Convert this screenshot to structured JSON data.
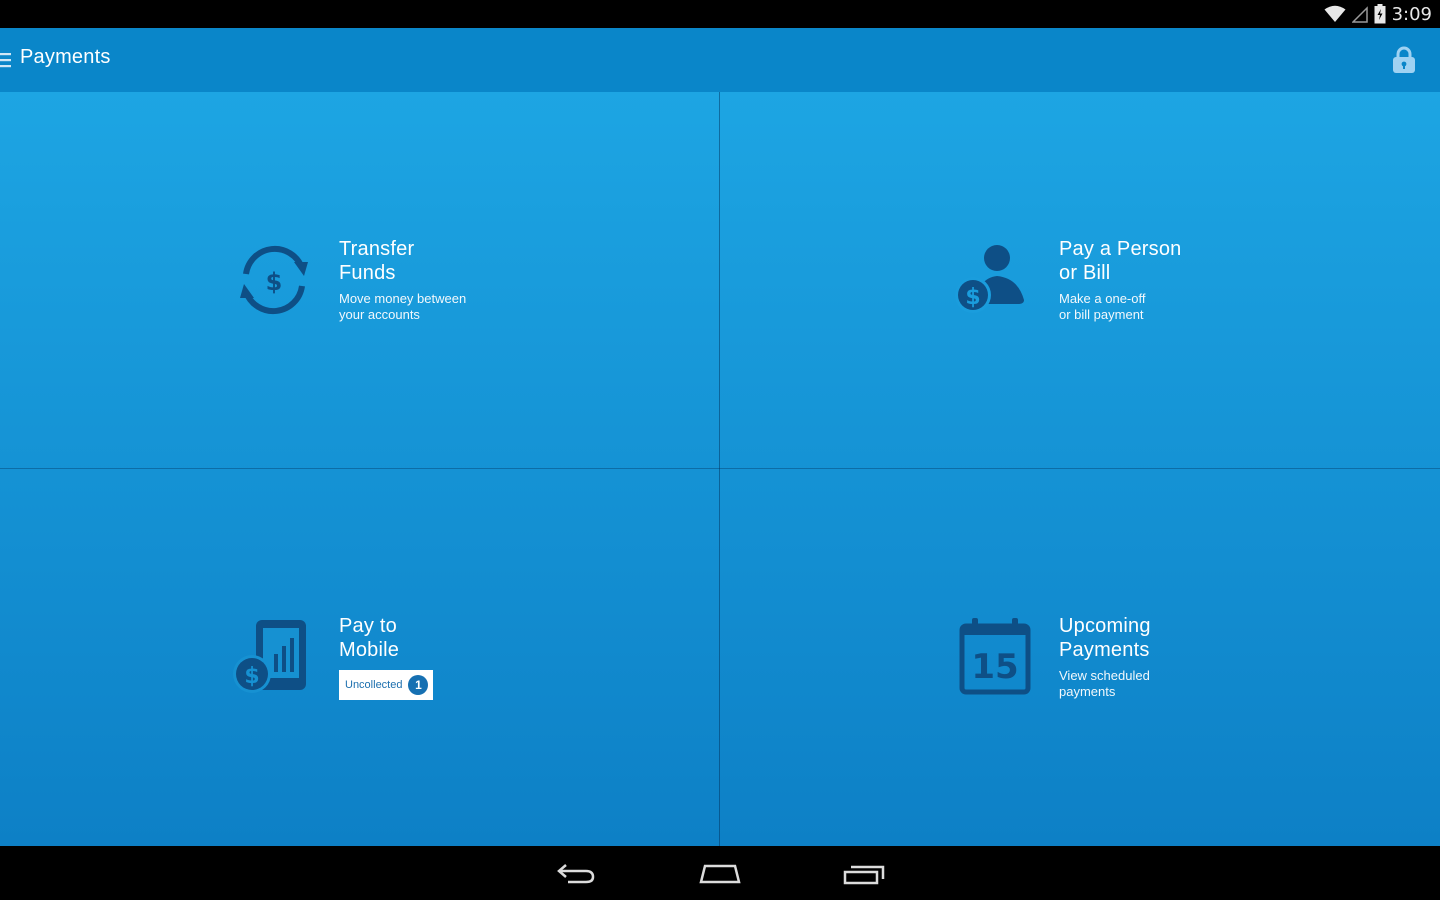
{
  "status": {
    "time": "3:09"
  },
  "appbar": {
    "title": "Payments",
    "menu_icon": "hamburger-menu-icon",
    "lock_icon": "lock-icon"
  },
  "tiles": [
    {
      "title_line1": "Transfer",
      "title_line2": "Funds",
      "desc_line1": "Move money between",
      "desc_line2": "your accounts",
      "icon": "transfer-funds-icon"
    },
    {
      "title_line1": "Pay a Person",
      "title_line2": "or Bill",
      "desc_line1": "Make a one-off",
      "desc_line2": "or bill payment",
      "icon": "pay-person-icon"
    },
    {
      "title_line1": "Pay to",
      "title_line2": "Mobile",
      "badge_label": "Uncollected",
      "badge_count": "1",
      "icon": "pay-to-mobile-icon"
    },
    {
      "title_line1": "Upcoming",
      "title_line2": "Payments",
      "desc_line1": "View scheduled",
      "desc_line2": "payments",
      "calendar_day": "15",
      "icon": "calendar-icon"
    }
  ],
  "colors": {
    "appbar": "#0a86c9",
    "tile_top": "#1da5e3",
    "tile_bottom": "#0d80c6",
    "icon": "#0e4f86"
  }
}
